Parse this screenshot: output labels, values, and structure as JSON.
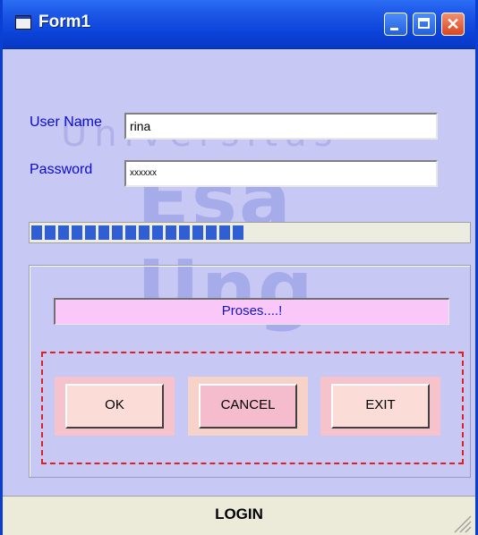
{
  "window": {
    "title": "Form1",
    "icon": "form-icon",
    "controls": [
      "minimize-icon",
      "maximize-icon",
      "close-icon"
    ],
    "close_glyph": "✕"
  },
  "watermark": {
    "line1": "Universitas",
    "line2": "Esa Ung"
  },
  "login_form": {
    "username_label": "User Name",
    "username_value": "rina",
    "password_label": "Password",
    "password_value": "xxxxxx"
  },
  "progress": {
    "value_fraction": 0.49
  },
  "process_status": "Proses....!",
  "buttons": {
    "ok": "OK",
    "cancel": "CANCEL",
    "exit": "EXIT"
  },
  "status_bar": {
    "text": "LOGIN"
  },
  "colors": {
    "form_background": "#c8c8f4",
    "label_text": "#0a0ad0",
    "progress_fill": "#2f5fd2",
    "status_panel": "#f9c8f8",
    "frame_border": "#e02020"
  }
}
